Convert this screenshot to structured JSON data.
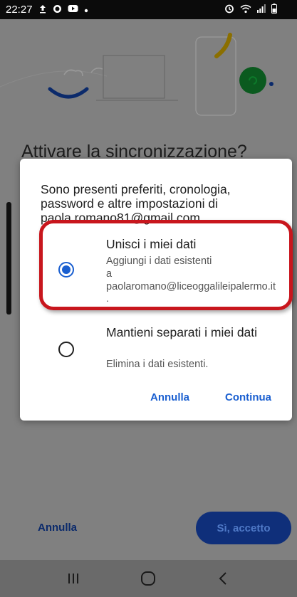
{
  "status_bar": {
    "time": "22:27",
    "left_icons": [
      "upload-icon",
      "whatsapp-icon",
      "youtube-icon",
      "dot-icon"
    ],
    "right_icons": [
      "alarm-icon",
      "wifi-icon",
      "signal-icon",
      "battery-icon"
    ]
  },
  "background": {
    "heading": "Attivare la sincronizzazione?",
    "cancel_label": "Annulla",
    "accept_label": "Sì, accetto"
  },
  "dialog": {
    "message": "Sono presenti preferiti, cronologia, password e altre impostazioni di paola.romano81@gmail.com.",
    "options": [
      {
        "title": "Unisci i miei dati",
        "description": "Aggiungi i dati esistenti a paolaromano@liceoggalileipalermo.it",
        "trailing": ".",
        "selected": true
      },
      {
        "title": "Mantieni separati i miei dati",
        "description": "Elimina i dati esistenti.",
        "selected": false
      }
    ],
    "cancel_label": "Annulla",
    "continue_label": "Continua"
  },
  "nav_bar": {
    "icons": [
      "recent-apps-icon",
      "home-icon",
      "back-icon"
    ]
  },
  "colors": {
    "accent": "#1a5fd0",
    "highlight": "#c8161d",
    "scrim": "#808080"
  }
}
